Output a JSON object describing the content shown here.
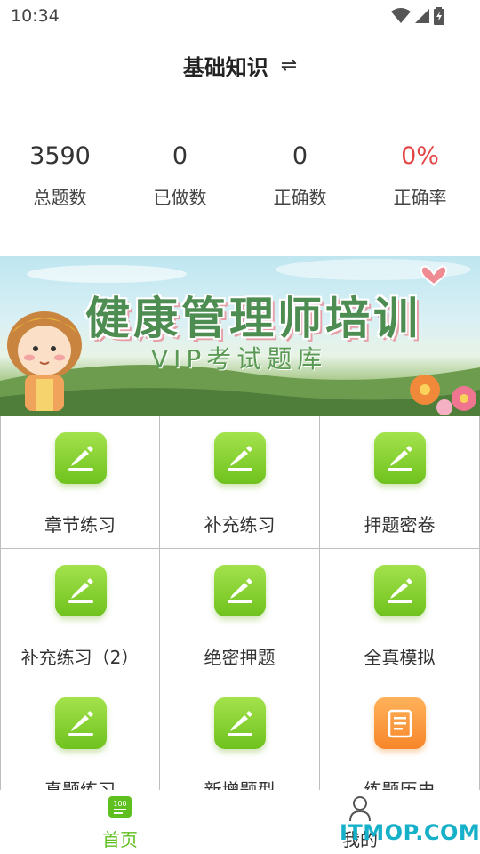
{
  "status": {
    "time": "10:34"
  },
  "header": {
    "title": "基础知识",
    "swap_glyph": "⇌"
  },
  "stats": [
    {
      "value": "3590",
      "label": "总题数"
    },
    {
      "value": "0",
      "label": "已做数"
    },
    {
      "value": "0",
      "label": "正确数"
    },
    {
      "value": "0%",
      "label": "正确率"
    }
  ],
  "banner": {
    "title": "健康管理师培训",
    "subtitle": "VIP考试题库"
  },
  "grid": [
    {
      "label": "章节练习",
      "icon": "pencil-edit-icon",
      "color": "#7bc72a"
    },
    {
      "label": "补充练习",
      "icon": "pencil-edit-icon",
      "color": "#7bc72a"
    },
    {
      "label": "押题密卷",
      "icon": "pencil-edit-icon",
      "color": "#7bc72a"
    },
    {
      "label": "补充练习（2）",
      "icon": "pencil-edit-icon",
      "color": "#7bc72a"
    },
    {
      "label": "绝密押题",
      "icon": "pencil-edit-icon",
      "color": "#7bc72a"
    },
    {
      "label": "全真模拟",
      "icon": "pencil-edit-icon",
      "color": "#7bc72a"
    },
    {
      "label": "真题练习",
      "icon": "pencil-edit-icon",
      "color": "#7bc72a"
    },
    {
      "label": "新增题型",
      "icon": "pencil-edit-icon",
      "color": "#7bc72a"
    },
    {
      "label": "练题历史",
      "icon": "document-list-icon",
      "color": "#f7922f"
    }
  ],
  "tabbar": {
    "home": {
      "label": "首页",
      "badge": "100",
      "icon": "home-100-icon"
    },
    "mine": {
      "label": "我的",
      "icon": "person-icon"
    }
  },
  "watermark": "ITMOP.COM",
  "colors": {
    "accent_green": "#5fbf1e",
    "rate_red": "#e24545"
  }
}
